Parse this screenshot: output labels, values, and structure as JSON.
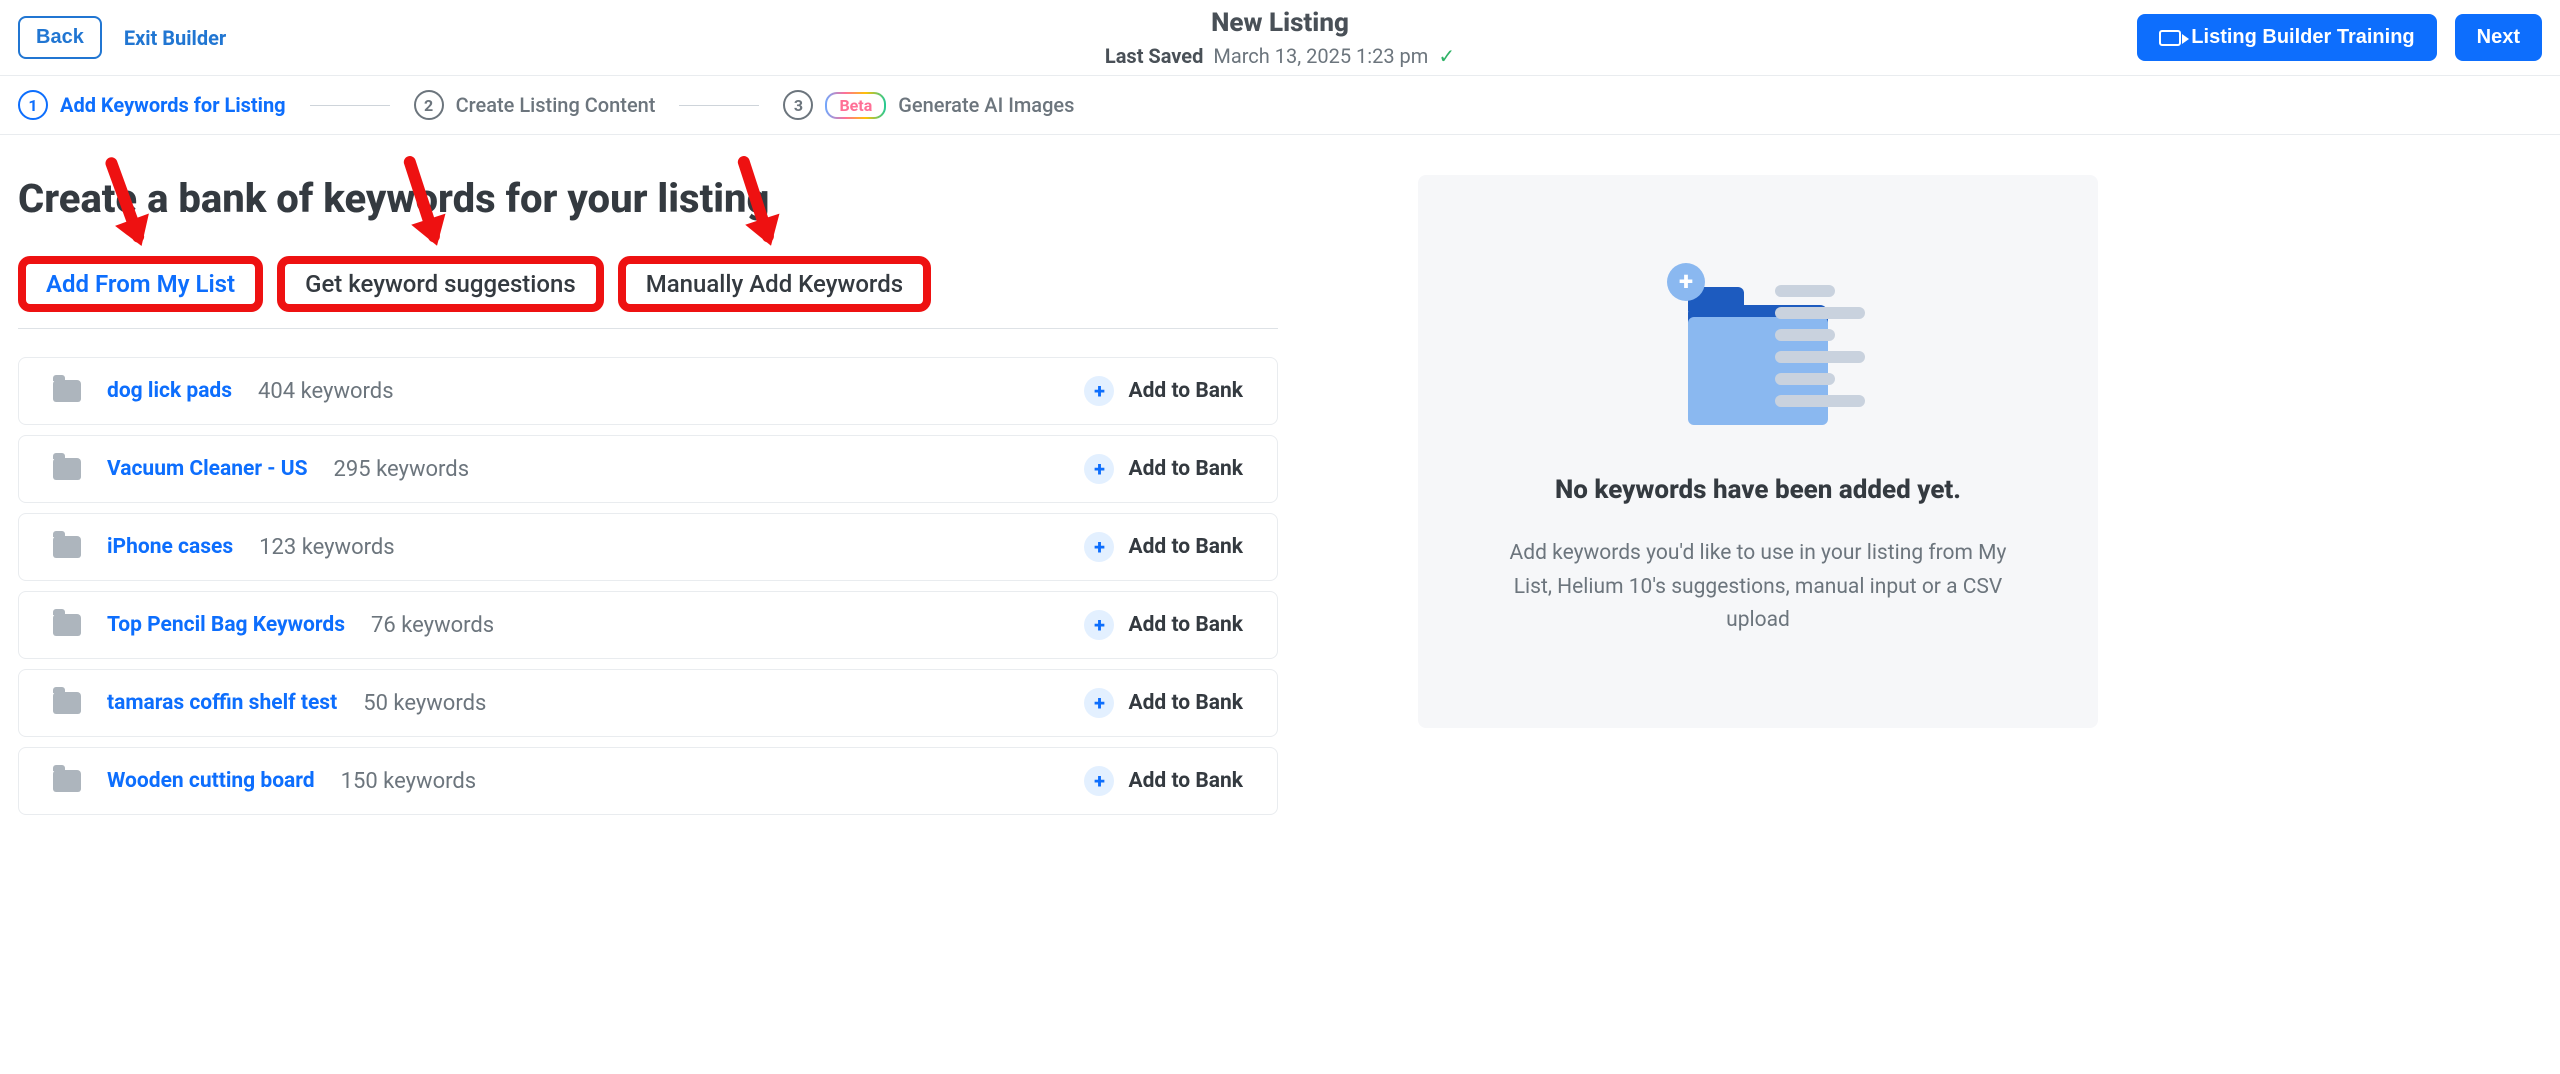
{
  "topbar": {
    "back": "Back",
    "exit": "Exit Builder",
    "title": "New Listing",
    "saved_label": "Last Saved",
    "saved_time": "March 13, 2025 1:23 pm",
    "training": "Listing Builder Training",
    "next": "Next"
  },
  "steps": {
    "one": "1",
    "one_label": "Add Keywords for Listing",
    "two": "2",
    "two_label": "Create Listing Content",
    "three": "3",
    "beta": "Beta",
    "three_label": "Generate AI Images"
  },
  "heading": "Create a bank of keywords for your listing",
  "tabs": {
    "from_list": "Add From My List",
    "suggestions": "Get keyword suggestions",
    "manual": "Manually Add Keywords"
  },
  "add_to_bank": "Add to Bank",
  "lists": [
    {
      "name": "dog lick pads",
      "count": "404 keywords"
    },
    {
      "name": "Vacuum Cleaner - US",
      "count": "295 keywords"
    },
    {
      "name": "iPhone cases",
      "count": "123 keywords"
    },
    {
      "name": "Top Pencil Bag Keywords",
      "count": "76 keywords"
    },
    {
      "name": "tamaras coffin shelf test",
      "count": "50 keywords"
    },
    {
      "name": "Wooden cutting board",
      "count": "150 keywords"
    }
  ],
  "empty": {
    "title": "No keywords have been added yet.",
    "subtitle": "Add keywords you'd like to use in your listing from My List, Helium 10's suggestions, manual input or a CSV upload"
  }
}
